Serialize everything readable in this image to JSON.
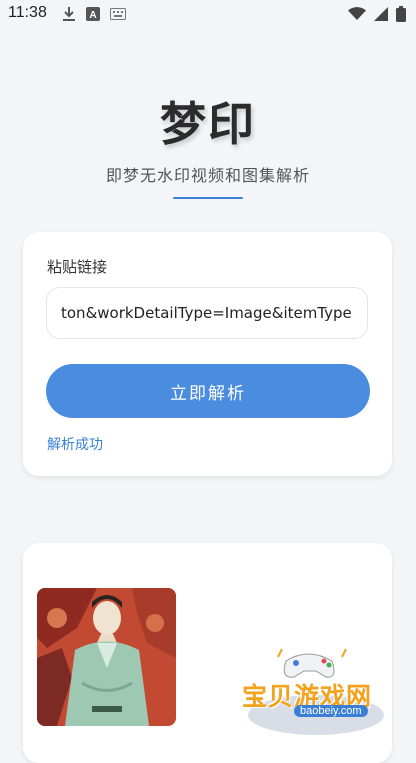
{
  "status_bar": {
    "time": "11:38",
    "left_icons": [
      "download-icon",
      "font-a-icon",
      "keyboard-icon"
    ],
    "right_icons": [
      "wifi-icon",
      "signal-icon",
      "battery-icon"
    ]
  },
  "header": {
    "title": "梦印",
    "subtitle": "即梦无水印视频和图集解析"
  },
  "input_card": {
    "label": "粘贴链接",
    "url_value": "ton&workDetailType=Image&itemType=9",
    "parse_button_label": "立即解析",
    "status_message": "解析成功"
  },
  "watermark": {
    "text": "宝贝游戏网",
    "url": "baobeiy.com"
  },
  "colors": {
    "accent": "#4a8ddf",
    "link": "#3b82d9",
    "background": "#f4f5f9"
  }
}
